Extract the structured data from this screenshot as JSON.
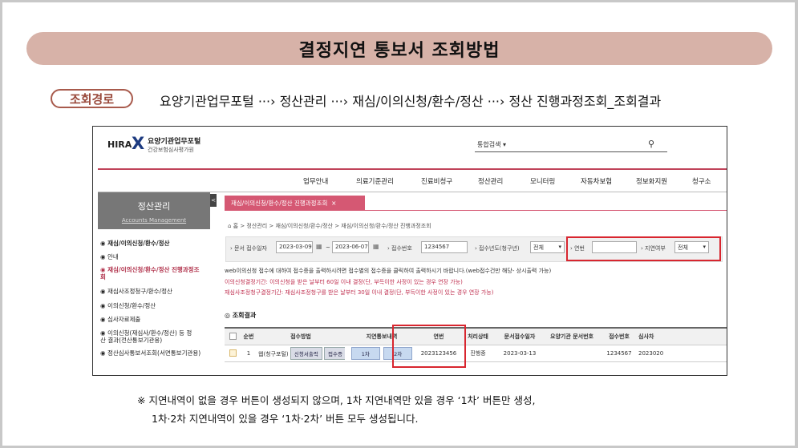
{
  "banner": {
    "title": "결정지연 통보서 조회방법"
  },
  "path": {
    "label": "조회경로",
    "text": "요양기관업무포털 ···› 정산관리 ···› 재심/이의신청/환수/정산 ···› 정산 진행과정조회_조회결과"
  },
  "portal": {
    "logo": {
      "hira": "HIRA",
      "name": "요양기관업무포털",
      "sub": "건강보험심사평가원"
    },
    "search": {
      "select": "통합검색 ▾",
      "icon": "search-icon"
    },
    "gnav": [
      "업무안내",
      "의료기준관리",
      "진료비청구",
      "정산관리",
      "모니터링",
      "자동차보험",
      "정보화지원",
      "청구소"
    ],
    "lnb": {
      "title": "정산관리",
      "sub": "Accounts Management",
      "toggle": "<",
      "items": [
        "재심/이의신청/환수/정산",
        "안내",
        "재심/이의신청/환수/정산 진행과정조회",
        "재심사조정청구/환수/정산",
        "이의신청/환수/정산",
        "심사자료제출",
        "이의신청(재심사/환수/정산) 등 정산 결과(전산통보기관용)",
        "정산심사통보서조회(서면통보기관용)"
      ]
    },
    "tab": {
      "label": "재심/이의신청/환수/정산 진행과정조회",
      "close": "×"
    },
    "breadcrumb": "⌂ 홈 > 정산관리 > 재심/이의신청/환수/정산 > 재심/이의신청/환수/정산 진행과정조회",
    "filters": {
      "date_label": "› 문서 접수일자",
      "date_from": "2023-03-09",
      "tilde": "~",
      "date_to": "2023-06-07",
      "cal": "▦",
      "rcpt_label": "› 접수번호",
      "rcpt_value": "1234567",
      "year_label": "› 접수년도(청구년)",
      "year_value": "전체",
      "serial_label": "› 연번",
      "serial_value": "",
      "delay_label": "› 지연여부",
      "delay_value": "전체",
      "arrow": "▾"
    },
    "info": [
      "web이의신청 접수에 대하여 접수증을 출력하시려면 접수별의 접수증을 클릭하여 출력하시기 바랍니다.(web접수건만 해당- 상시출력 가능)",
      "이의신청결정기간:         이의신청을 받은 날부터 60일 이내 결정(단, 부득이한 사정이 있는 경우 연장 가능)",
      "재심사조정청구결정기간:   재심사조정청구를 받은 날부터 30일 이내 결정(단, 부득이한 사정이 있는 경우 연장 가능)"
    ],
    "result_title": "◎ 조회결과",
    "table": {
      "headers": [
        "",
        "순번",
        "접수방법",
        "지연통보내역",
        "연번",
        "처리상태",
        "문서접수일자",
        "요양기관 문서번호",
        "접수번호",
        "심사차"
      ],
      "row": {
        "no": "1",
        "method": "웹(청구포털)",
        "btn_print": "신청서출력",
        "btn_receipt": "접수증",
        "delay1": "1차",
        "delay2": "2차",
        "serial": "2023123456",
        "status": "진행중",
        "date": "2023-03-13",
        "doc_no": "",
        "rcpt_no": "1234567",
        "review": "2023020"
      }
    }
  },
  "notes": [
    "※ 지연내역이 없을 경우 버튼이 생성되지 않으며, 1차 지연내역만 있을 경우 ‘1차’ 버튼만 생성,",
    "1차·2차 지연내역이 있을 경우 ‘1차·2차’ 버튼 모두 생성됩니다."
  ],
  "colors": {
    "banner": "#d7b2a8",
    "accent": "#d55873",
    "highlight": "#d8262f"
  }
}
